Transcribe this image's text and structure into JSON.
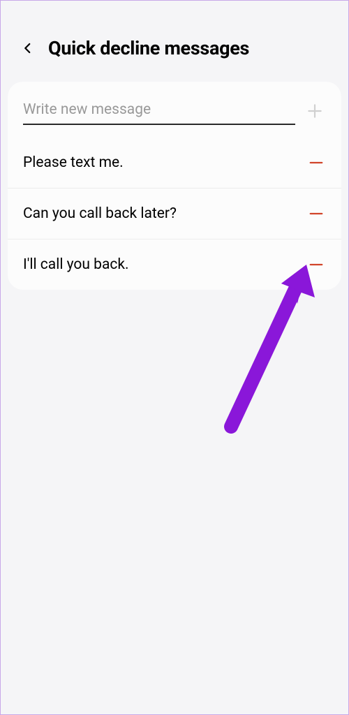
{
  "header": {
    "title": "Quick decline messages"
  },
  "input": {
    "placeholder": "Write new message",
    "value": ""
  },
  "messages": [
    {
      "text": "Please text me."
    },
    {
      "text": "Can you call back later?"
    },
    {
      "text": "I'll call you back."
    }
  ],
  "colors": {
    "remove": "#d1452a",
    "arrow": "#8a17d9"
  }
}
